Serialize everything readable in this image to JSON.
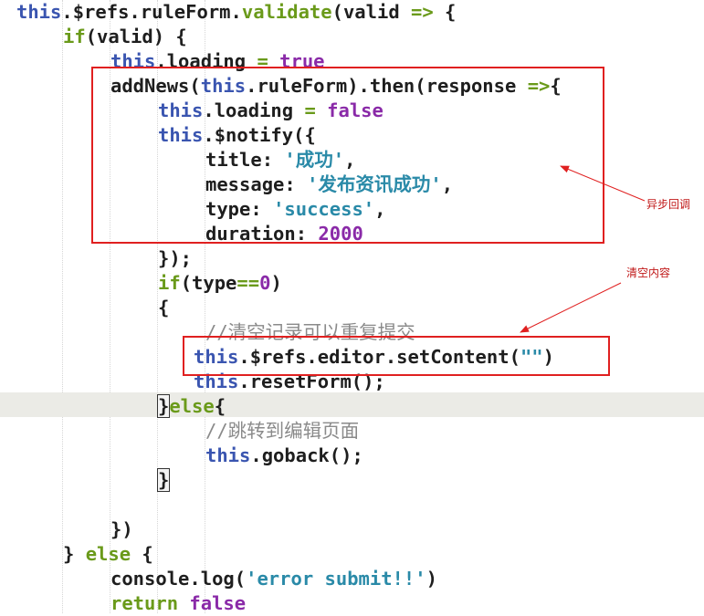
{
  "code_lines": [
    {
      "tokens": [
        {
          "t": "this",
          "c": "th"
        },
        {
          "t": ".$refs.ruleForm.",
          "c": "fn"
        },
        {
          "t": "validate",
          "c": "op"
        },
        {
          "t": "(valid ",
          "c": "fn"
        },
        {
          "t": "=>",
          "c": "op"
        },
        {
          "t": " {",
          "c": "fn"
        }
      ]
    },
    {
      "tokens": [
        {
          "t": "if",
          "c": "op"
        },
        {
          "t": "(valid) {",
          "c": "fn"
        }
      ]
    },
    {
      "tokens": [
        {
          "t": "this",
          "c": "th"
        },
        {
          "t": ".loading ",
          "c": "fn"
        },
        {
          "t": "=",
          "c": "op"
        },
        {
          "t": " true",
          "c": "bool"
        }
      ]
    },
    {
      "tokens": [
        {
          "t": "addNews(",
          "c": "fn"
        },
        {
          "t": "this",
          "c": "th"
        },
        {
          "t": ".ruleForm).then(response ",
          "c": "fn"
        },
        {
          "t": "=>",
          "c": "op"
        },
        {
          "t": "{",
          "c": "fn"
        }
      ]
    },
    {
      "tokens": [
        {
          "t": "this",
          "c": "th"
        },
        {
          "t": ".loading ",
          "c": "fn"
        },
        {
          "t": "=",
          "c": "op"
        },
        {
          "t": " false",
          "c": "bool"
        }
      ]
    },
    {
      "tokens": [
        {
          "t": "this",
          "c": "th"
        },
        {
          "t": ".$notify({",
          "c": "fn"
        }
      ]
    },
    {
      "tokens": [
        {
          "t": "title: ",
          "c": "fn"
        },
        {
          "t": "'成功'",
          "c": "str"
        },
        {
          "t": ",",
          "c": "fn"
        }
      ]
    },
    {
      "tokens": [
        {
          "t": "message: ",
          "c": "fn"
        },
        {
          "t": "'发布资讯成功'",
          "c": "str"
        },
        {
          "t": ",",
          "c": "fn"
        }
      ]
    },
    {
      "tokens": [
        {
          "t": "type: ",
          "c": "fn"
        },
        {
          "t": "'success'",
          "c": "str"
        },
        {
          "t": ",",
          "c": "fn"
        }
      ]
    },
    {
      "tokens": [
        {
          "t": "duration: ",
          "c": "fn"
        },
        {
          "t": "2000",
          "c": "num"
        }
      ]
    },
    {
      "tokens": [
        {
          "t": "});",
          "c": "fn"
        }
      ]
    },
    {
      "tokens": [
        {
          "t": "if",
          "c": "op"
        },
        {
          "t": "(type",
          "c": "fn"
        },
        {
          "t": "==",
          "c": "op"
        },
        {
          "t": "0",
          "c": "num"
        },
        {
          "t": ")",
          "c": "fn"
        }
      ]
    },
    {
      "tokens": [
        {
          "t": "{",
          "c": "fn"
        }
      ]
    },
    {
      "tokens": [
        {
          "t": "//清空记录可以重复提交",
          "c": "cm"
        }
      ]
    },
    {
      "tokens": [
        {
          "t": "this",
          "c": "th"
        },
        {
          "t": ".$refs.editor.setContent(",
          "c": "fn"
        },
        {
          "t": "\"\"",
          "c": "str"
        },
        {
          "t": ")",
          "c": "fn"
        }
      ]
    },
    {
      "tokens": [
        {
          "t": "this",
          "c": "th"
        },
        {
          "t": ".resetForm();",
          "c": "fn"
        }
      ]
    },
    {
      "tokens": [
        {
          "t": "}",
          "c": "fn"
        },
        {
          "t": "else",
          "c": "op"
        },
        {
          "t": "{",
          "c": "fn"
        }
      ]
    },
    {
      "tokens": [
        {
          "t": "//跳转到编辑页面",
          "c": "cm"
        }
      ]
    },
    {
      "tokens": [
        {
          "t": "this",
          "c": "th"
        },
        {
          "t": ".goback();",
          "c": "fn"
        }
      ]
    },
    {
      "tokens": [
        {
          "t": "}",
          "c": "fn"
        }
      ]
    },
    {
      "tokens": []
    },
    {
      "tokens": [
        {
          "t": "})",
          "c": "fn"
        }
      ]
    },
    {
      "tokens": [
        {
          "t": "} ",
          "c": "fn"
        },
        {
          "t": "else",
          "c": "op"
        },
        {
          "t": " {",
          "c": "fn"
        }
      ]
    },
    {
      "tokens": [
        {
          "t": "console.log(",
          "c": "fn"
        },
        {
          "t": "'error submit!!'",
          "c": "str"
        },
        {
          "t": ")",
          "c": "fn"
        }
      ]
    },
    {
      "tokens": [
        {
          "t": "return",
          "c": "op"
        },
        {
          "t": " false",
          "c": "bool"
        }
      ]
    }
  ],
  "annotations": {
    "async_label": "异步回调",
    "clear_label": "清空内容"
  },
  "colors": {
    "annotation": "#e02020",
    "keyword": "#6a9a1a",
    "this": "#3a55b0",
    "string": "#2a8aa8",
    "number": "#8a2aa8",
    "comment": "#8a8a8a",
    "current_line": "#ebebe6"
  }
}
